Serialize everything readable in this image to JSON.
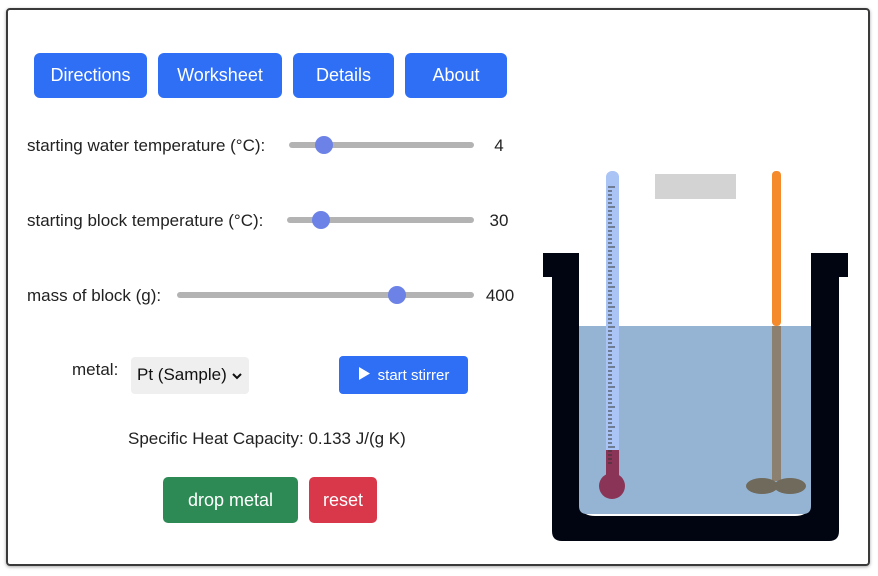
{
  "nav": {
    "directions_label": "Directions",
    "worksheet_label": "Worksheet",
    "details_label": "Details",
    "about_label": "About"
  },
  "controls": {
    "water_temp": {
      "label": "starting water temperature (°C):",
      "value": "4",
      "fraction": 0.19
    },
    "block_temp": {
      "label": "starting block temperature (°C):",
      "value": "30",
      "fraction": 0.18
    },
    "mass": {
      "label": "mass of block (g):",
      "value": "400",
      "fraction": 0.74
    },
    "metal": {
      "label": "metal:",
      "selected": "Pt (Sample)"
    }
  },
  "stirrer_label": "start stirrer",
  "specific_heat_text": "Specific Heat Capacity: 0.133 J/(g K)",
  "drop_label": "drop metal",
  "reset_label": "reset",
  "colors": {
    "primary": "#2f6ff5",
    "success": "#2e8a54",
    "danger": "#d9384a",
    "water": "#95b4d3",
    "vessel": "#000511",
    "stirrer_rod": "#f58a2a"
  }
}
